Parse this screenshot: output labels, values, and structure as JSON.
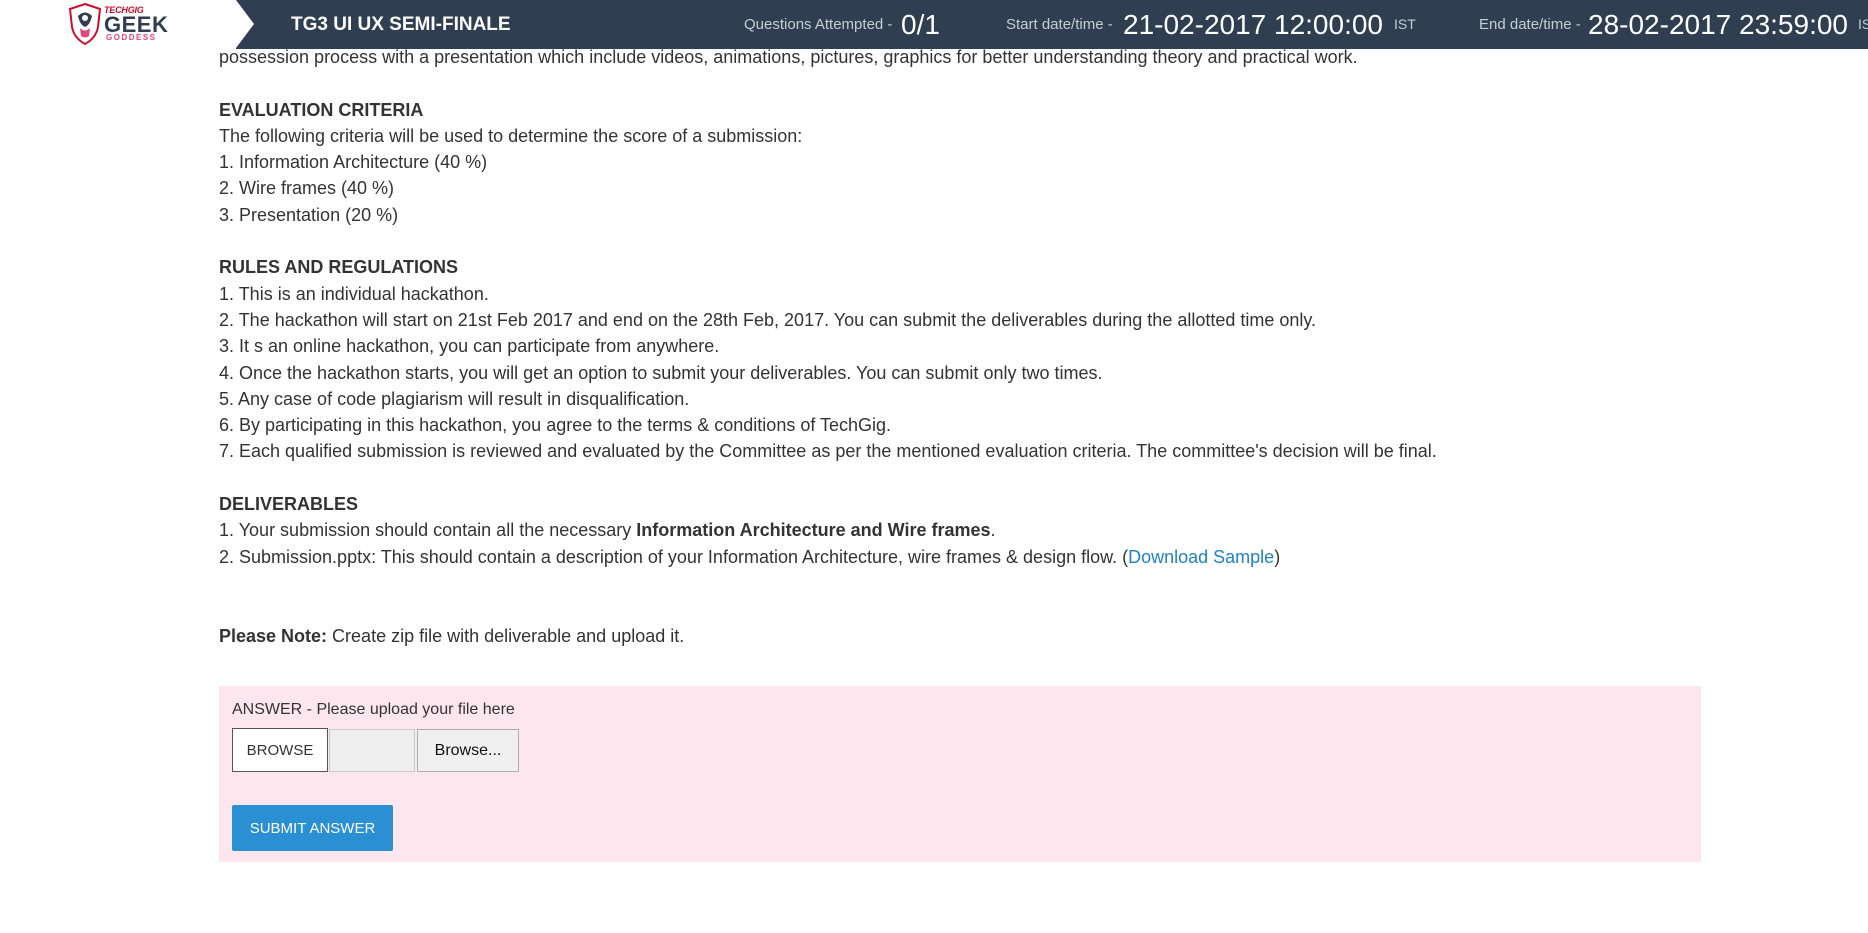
{
  "header": {
    "logo_top": "TECHGIG",
    "logo_main": "GEEK",
    "logo_sub": "GODDESS",
    "title": "TG3 UI UX SEMI-FINALE",
    "questions_label": "Questions Attempted -",
    "questions_value": "0/1",
    "start_label": "Start date/time -",
    "start_value": "21-02-2017 12:00:00",
    "start_tz": "IST",
    "end_label": "End date/time -",
    "end_value": "28-02-2017 23:59:00",
    "end_tz": "IS"
  },
  "content": {
    "intro_tail": "possession process with a presentation which include videos, animations, pictures, graphics for better understanding theory and practical work.",
    "evaluation": {
      "heading": "EVALUATION CRITERIA",
      "intro": "The following criteria will be used to determine the score of a submission:",
      "items": [
        "1. Information Architecture (40 %)",
        "2. Wire frames (40 %)",
        "3. Presentation (20 %)"
      ]
    },
    "rules": {
      "heading": "RULES AND REGULATIONS",
      "items": [
        "1. This is an individual hackathon.",
        "2. The hackathon will start on 21st Feb 2017 and end on the 28th Feb, 2017. You can submit the deliverables during the allotted time only.",
        "3. It s an online hackathon, you can participate from anywhere.",
        "4. Once the hackathon starts, you will get an option to submit your deliverables. You can submit only two times.",
        "5. Any case of code plagiarism will result in disqualification.",
        "6. By participating in this hackathon, you agree to the terms & conditions of TechGig.",
        "7. Each qualified submission is reviewed and evaluated by the Committee as per the mentioned evaluation criteria. The committee's decision will be final."
      ]
    },
    "deliverables": {
      "heading": "DELIVERABLES",
      "item1_prefix": "1. Your submission should contain all the necessary ",
      "item1_bold": "Information Architecture and Wire frames",
      "item1_suffix": ".",
      "item2_prefix": "2. Submission.pptx: This should contain a description of your Information Architecture, wire frames & design flow. (",
      "item2_link": "Download Sample",
      "item2_suffix": ")"
    },
    "note": {
      "bold": "Please Note:",
      "text": " Create zip file with deliverable and upload it."
    }
  },
  "answer": {
    "label": "ANSWER - Please upload your file here",
    "browse_label": "BROWSE",
    "file_value": "",
    "file_browse_label": "Browse...",
    "submit_label": "SUBMIT ANSWER"
  },
  "colors": {
    "header_bg": "#2f3e50",
    "answer_bg": "#fde6ee",
    "submit_bg": "#2b8fd4",
    "link": "#1f82c5"
  }
}
